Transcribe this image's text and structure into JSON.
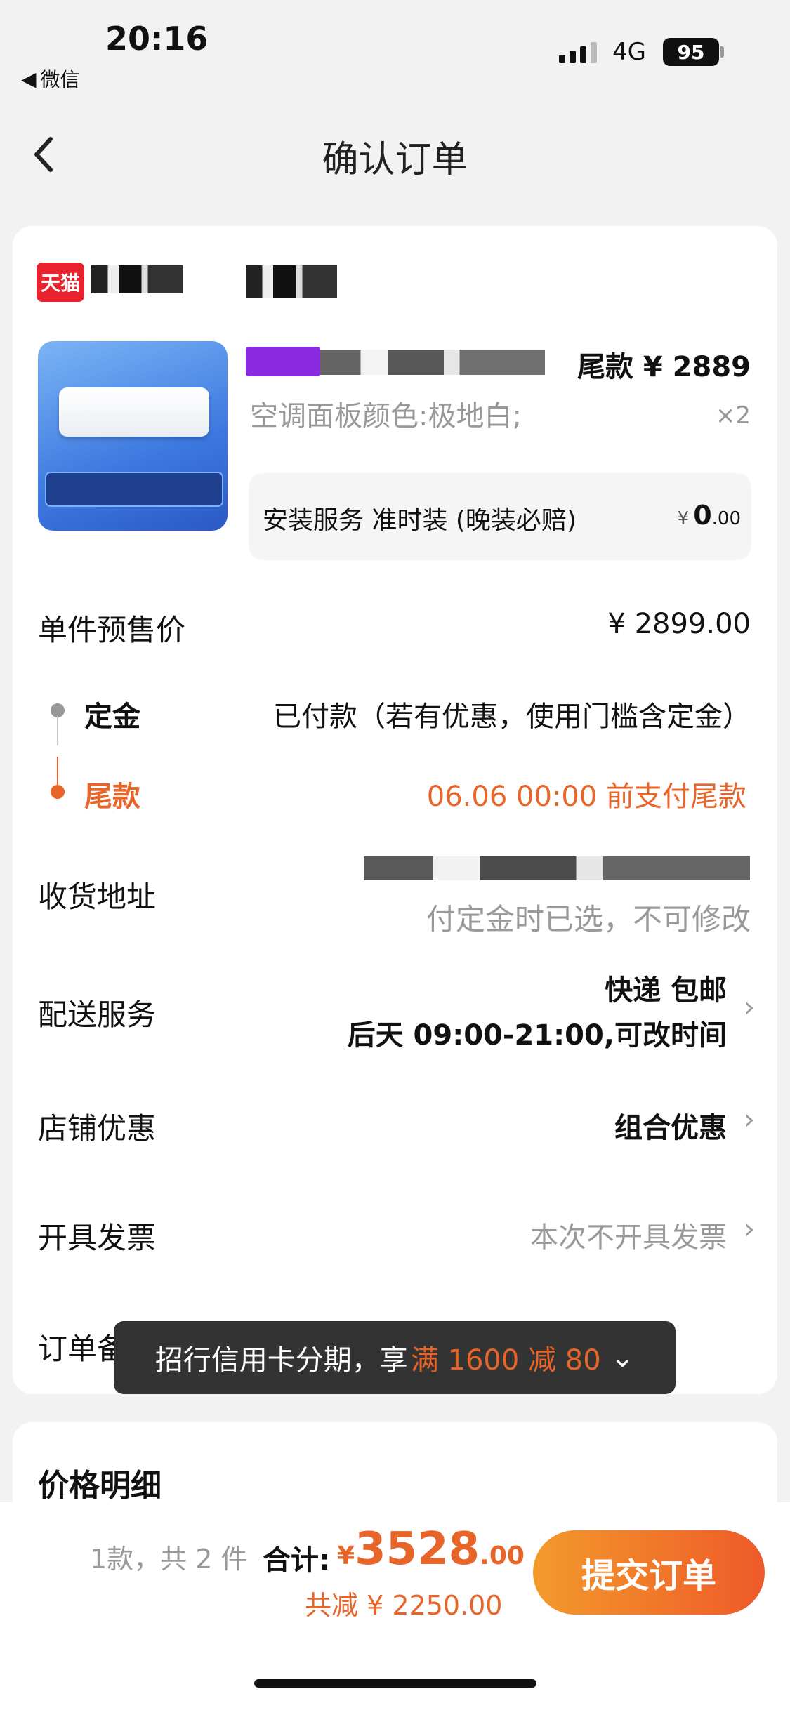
{
  "status": {
    "time": "20:16",
    "back_app": "微信",
    "network": "4G",
    "battery": "95"
  },
  "nav": {
    "title": "确认订单"
  },
  "shop": {
    "badge": "天猫"
  },
  "product": {
    "final_payment": "尾款 ¥ 2889",
    "spec": "空调面板颜色:极地白;",
    "quantity": "×2",
    "install_label": "安装服务 准时装 (晚装必赔)",
    "install_currency": "¥",
    "install_price": "0",
    "install_price_dec": ".00"
  },
  "rows": {
    "unit_price_label": "单件预售价",
    "unit_price_value": "¥ 2899.00",
    "deposit_label": "定金",
    "deposit_value": "已付款（若有优惠，使用门槛含定金）",
    "balance_label": "尾款",
    "balance_value": "06.06 00:00 前支付尾款",
    "address_label": "收货地址",
    "address_note": "付定金时已选，不可修改",
    "delivery_label": "配送服务",
    "delivery_line1": "快递 包邮",
    "delivery_line2": "后天 09:00-21:00,可改时间",
    "discount_label": "店铺优惠",
    "discount_value": "组合优惠",
    "invoice_label": "开具发票",
    "invoice_value": "本次不开具发票",
    "remark_label": "订单备"
  },
  "toast": {
    "prefix": "招行信用卡分期，享",
    "highlight": "满 1600 减 80"
  },
  "price_detail": {
    "title": "价格明细"
  },
  "footer": {
    "count": "1款，共 2 件",
    "total_label": "合计:",
    "currency": "¥",
    "total_int": "3528",
    "total_dec": ".00",
    "saved": "共减 ¥ 2250.00",
    "submit": "提交订单"
  },
  "colors": {
    "accent": "#e8652a",
    "tmall_red": "#e8232e"
  }
}
